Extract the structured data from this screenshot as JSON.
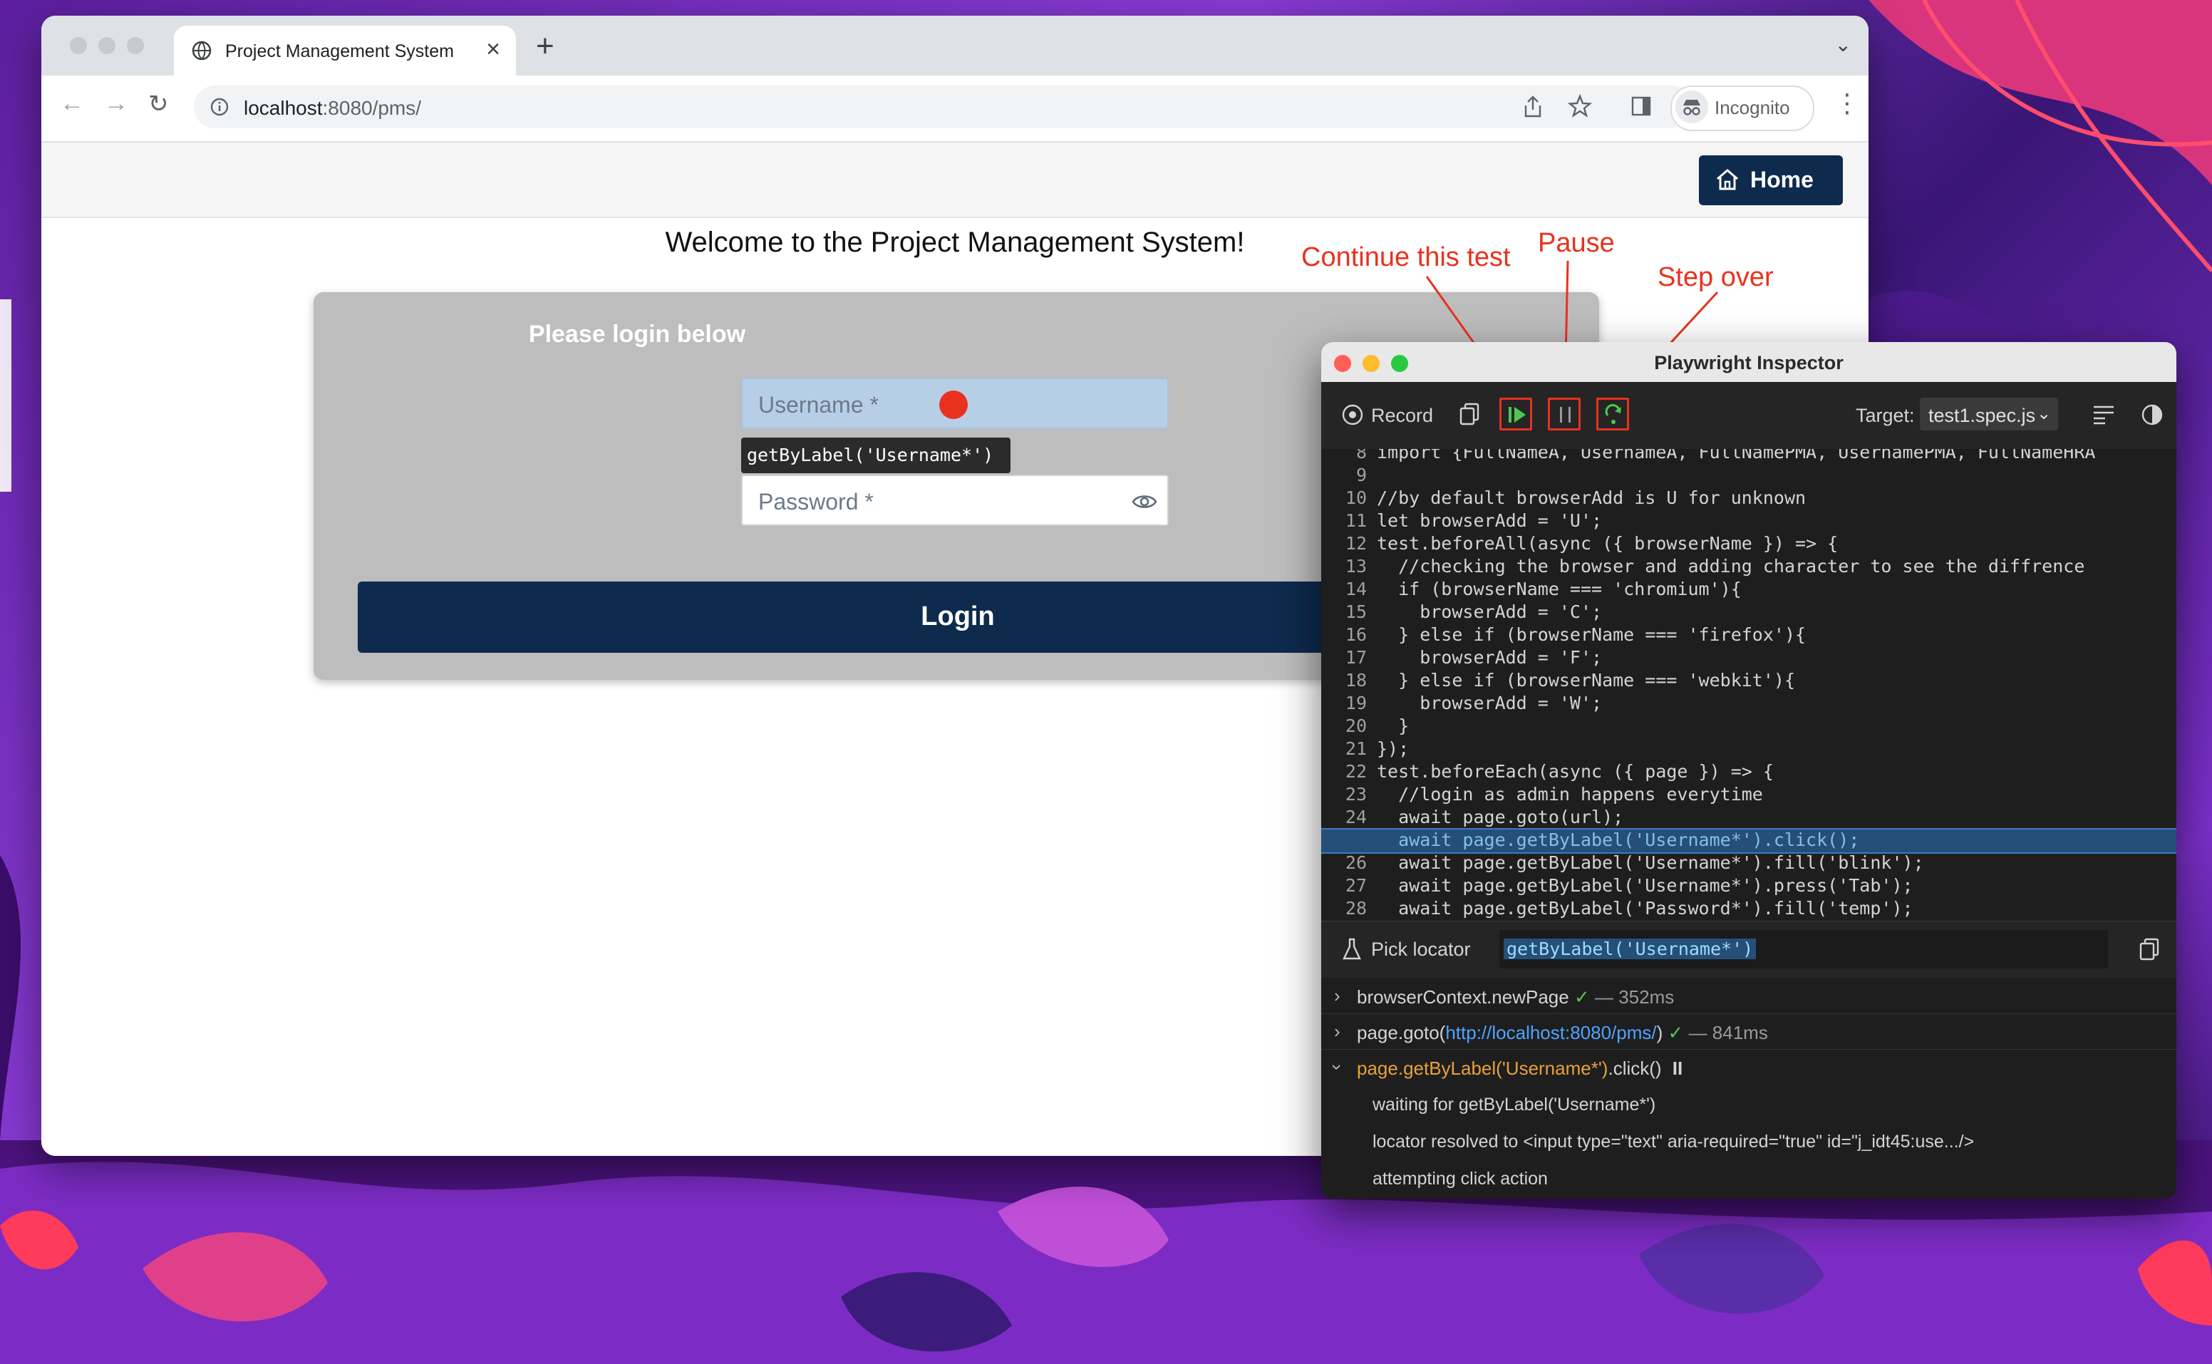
{
  "browser": {
    "tab_title": "Project Management System",
    "tab_close": "×",
    "new_tab": "+",
    "url_host": "localhost",
    "url_path": ":8080/pms/",
    "incognito_label": "Incognito"
  },
  "page": {
    "home_label": "Home",
    "welcome": "Welcome to the Project Management System!",
    "login_heading": "Please login below",
    "username_placeholder": "Username *",
    "password_placeholder": "Password *",
    "tooltip": "getByLabel('Username*')",
    "login_label": "Login"
  },
  "inspector": {
    "title": "Playwright Inspector",
    "record_label": "Record",
    "target_label": "Target:",
    "target_value": "test1.spec.js",
    "code_lines": [
      {
        "n": "8",
        "t": "import {FullNameA, UsernameA, FullNamePMA, UsernamePMA, FullNameHRA"
      },
      {
        "n": "9",
        "t": ""
      },
      {
        "n": "10",
        "t": "//by default browserAdd is U for unknown"
      },
      {
        "n": "11",
        "t": "let browserAdd = 'U';"
      },
      {
        "n": "12",
        "t": "test.beforeAll(async ({ browserName }) => {"
      },
      {
        "n": "13",
        "t": "  //checking the browser and adding character to see the diffrence"
      },
      {
        "n": "14",
        "t": "  if (browserName === 'chromium'){"
      },
      {
        "n": "15",
        "t": "    browserAdd = 'C';"
      },
      {
        "n": "16",
        "t": "  } else if (browserName === 'firefox'){"
      },
      {
        "n": "17",
        "t": "    browserAdd = 'F';"
      },
      {
        "n": "18",
        "t": "  } else if (browserName === 'webkit'){"
      },
      {
        "n": "19",
        "t": "    browserAdd = 'W';"
      },
      {
        "n": "20",
        "t": "  }"
      },
      {
        "n": "21",
        "t": "});"
      },
      {
        "n": "22",
        "t": "test.beforeEach(async ({ page }) => {"
      },
      {
        "n": "23",
        "t": "  //login as admin happens everytime"
      },
      {
        "n": "24",
        "t": "  await page.goto(url);"
      },
      {
        "n": "",
        "t": "  await page.getByLabel('Username*').click();",
        "highlight": true
      },
      {
        "n": "26",
        "t": "  await page.getByLabel('Username*').fill('blink');"
      },
      {
        "n": "27",
        "t": "  await page.getByLabel('Username*').press('Tab');"
      },
      {
        "n": "28",
        "t": "  await page.getByLabel('Password*').fill('temp');"
      }
    ],
    "pick_locator_label": "Pick locator",
    "pick_locator_value": "getByLabel('Username*')",
    "log": {
      "row1_text": "browserContext.newPage",
      "row1_time": "— 352ms",
      "row2_prefix": "page.goto(",
      "row2_url": "http://localhost:8080/pms/",
      "row2_suffix": ")",
      "row2_time": "— 841ms",
      "row3_call": "page.getByLabel('Username*')",
      "row3_method": ".click()",
      "row3_status": "II",
      "sub1": "waiting for getByLabel('Username*')",
      "sub2": "locator resolved to <input type=\"text\" aria-required=\"true\" id=\"j_idt45:use.../>",
      "sub3": "attempting click action"
    }
  },
  "annotations": {
    "continue": "Continue this test",
    "pause": "Pause",
    "step_over": "Step over",
    "color": "#e8321f"
  }
}
